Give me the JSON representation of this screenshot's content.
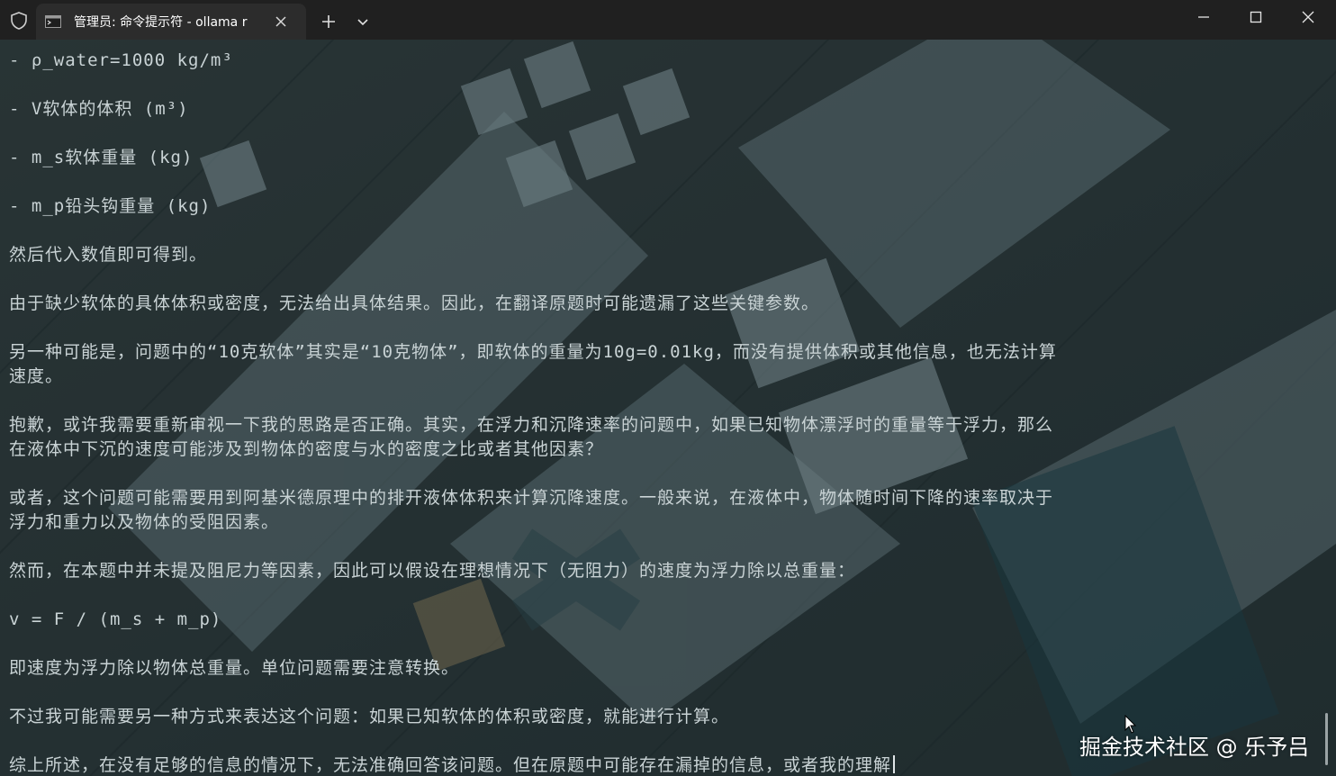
{
  "titlebar": {
    "tab_title": "管理员: 命令提示符 - ollama  r",
    "icons": {
      "shield": "shield-icon",
      "terminal": "terminal-icon",
      "close": "close-icon",
      "add": "plus-icon",
      "dropdown": "chevron-down-icon",
      "minimize": "minimize-icon",
      "maximize": "maximize-icon",
      "window_close": "close-icon"
    }
  },
  "terminal": {
    "lines": [
      "- ρ_water=1000 kg/m³",
      "- V软体的体积 (m³)",
      "- m_s软体重量 (kg)",
      "- m_p铅头钩重量 (kg)",
      "然后代入数值即可得到。",
      "由于缺少软体的具体体积或密度，无法给出具体结果。因此，在翻译原题时可能遗漏了这些关键参数。",
      "另一种可能是，问题中的“10克软体”其实是“10克物体”，即软体的重量为10g=0.01kg，而没有提供体积或其他信息，也无法计算",
      "速度。",
      "抱歉，或许我需要重新审视一下我的思路是否正确。其实，在浮力和沉降速率的问题中，如果已知物体漂浮时的重量等于浮力，那么",
      "在液体中下沉的速度可能涉及到物体的密度与水的密度之比或者其他因素？",
      "或者，这个问题可能需要用到阿基米德原理中的排开液体体积来计算沉降速度。一般来说，在液体中，物体随时间下降的速率取决于",
      "浮力和重力以及物体的受阻因素。",
      "然而，在本题中并未提及阻尼力等因素，因此可以假设在理想情况下（无阻力）的速度为浮力除以总重量：",
      "v = F / (m_s + m_p)",
      "即速度为浮力除以物体总重量。单位问题需要注意转换。",
      "不过我可能需要另一种方式来表达这个问题：如果已知软体的体积或密度，就能进行计算。",
      "综上所述，在没有足够的信息的情况下，无法准确回答该问题。但在原题中可能存在漏掉的信息，或者我的理解"
    ],
    "text_color": "#c9d3d5",
    "background_tint": "#14343c"
  },
  "watermark": {
    "text": "掘金技术社区 @ 乐予吕"
  }
}
